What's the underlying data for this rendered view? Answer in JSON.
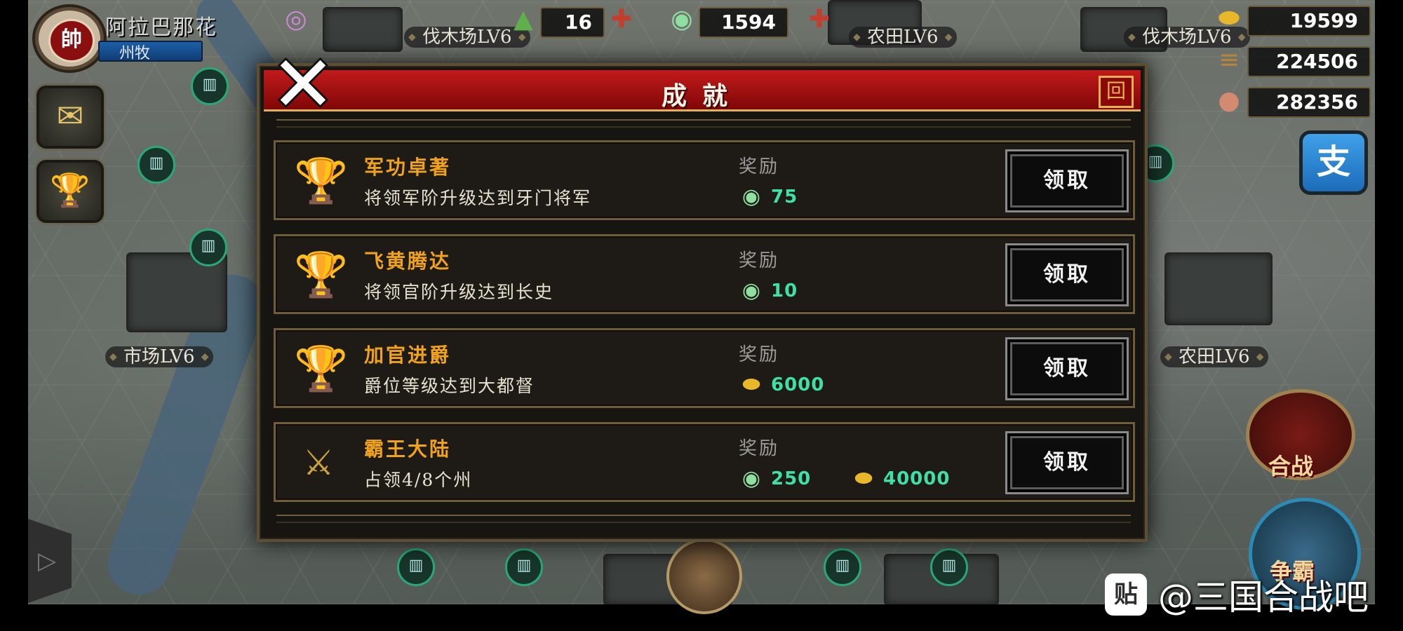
{
  "player": {
    "avatar_char": "帥",
    "name": "阿拉巴那花",
    "rank": "州牧"
  },
  "resources": {
    "soldiers": "16",
    "jade": "1594",
    "gold": "19599",
    "wood": "224506",
    "food": "282356"
  },
  "map_labels": {
    "lumber_1": "伐木场LV6",
    "farm_1": "农田LV6",
    "lumber_2": "伐木场LV6",
    "market": "市场LV6",
    "farm_2": "农田LV6"
  },
  "buttons": {
    "alipay": "支",
    "battle": "合战",
    "bawang": "争霸"
  },
  "dialog": {
    "title": "成就",
    "close_glyph": "✕",
    "corner": "回",
    "reward_label": "奖励",
    "claim_label": "领取",
    "achievements": [
      {
        "title": "军功卓著",
        "desc": "将领军阶升级达到牙门将军",
        "rewards": [
          {
            "icon": "jade",
            "value": "75"
          }
        ]
      },
      {
        "title": "飞黄腾达",
        "desc": "将领官阶升级达到长史",
        "rewards": [
          {
            "icon": "jade",
            "value": "10"
          }
        ]
      },
      {
        "title": "加官进爵",
        "desc": "爵位等级达到大都督",
        "rewards": [
          {
            "icon": "gold",
            "value": "6000"
          }
        ]
      },
      {
        "title": "霸王大陆",
        "desc": "占领4/8个州",
        "rewards": [
          {
            "icon": "jade",
            "value": "250"
          },
          {
            "icon": "gold",
            "value": "40000"
          }
        ]
      }
    ]
  },
  "watermark": {
    "icon": "贴",
    "text": "@三国合战吧"
  }
}
